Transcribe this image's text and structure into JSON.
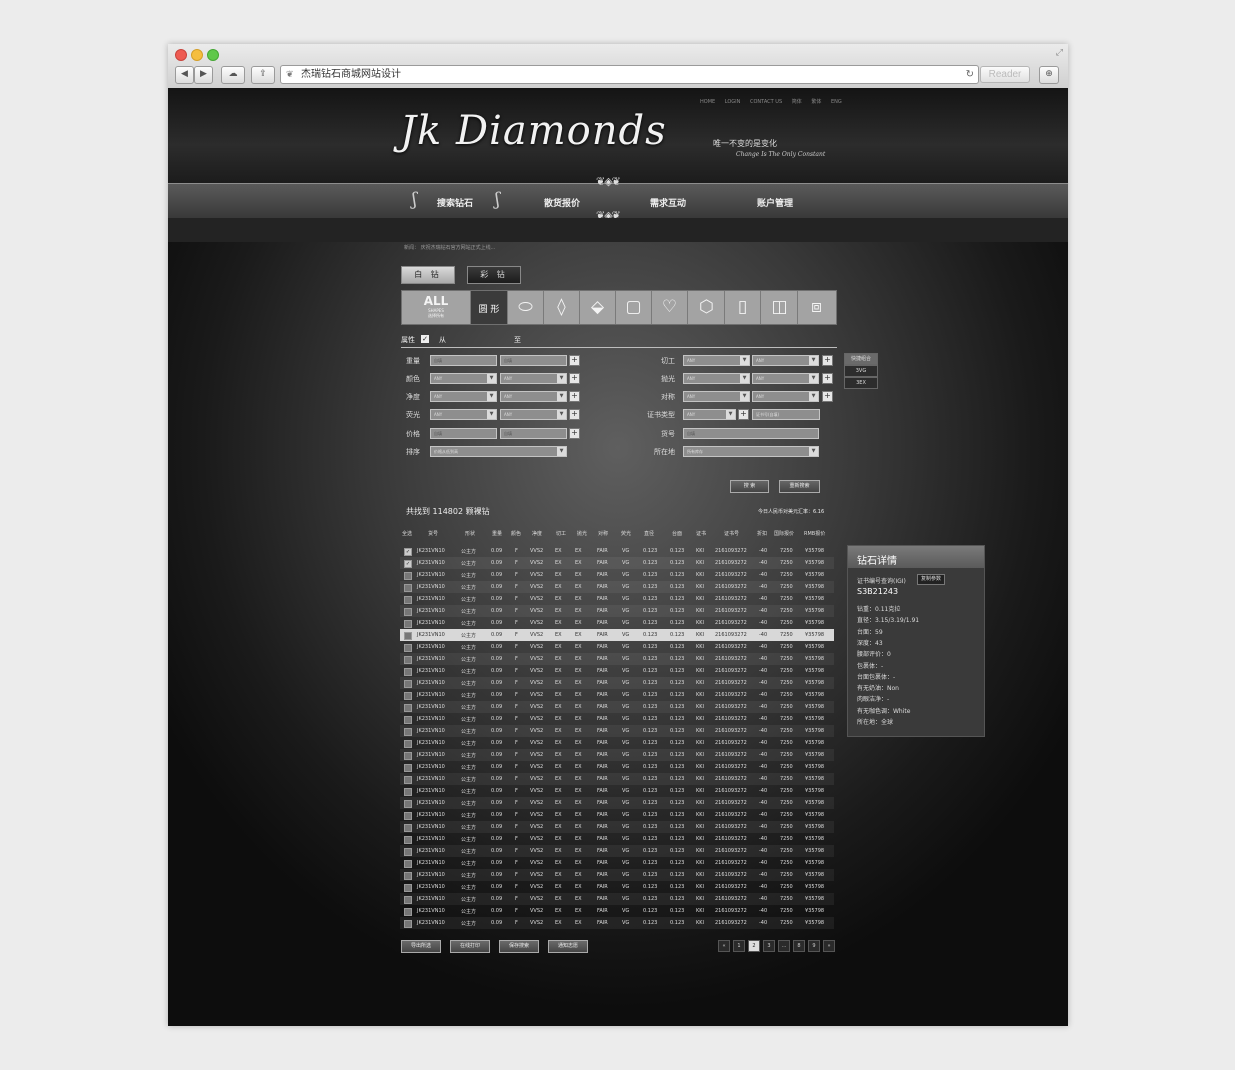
{
  "browser": {
    "address": "杰瑞钻石商城网站设计",
    "reader_label": "Reader"
  },
  "header": {
    "toplinks": [
      "HOME",
      "LOGIN",
      "CONTACT US",
      "简体",
      "繁体",
      "ENG"
    ],
    "logo": "Jk Diamonds",
    "slogan_cn": "唯一不变的是变化",
    "slogan_en": "Change Is The Only Constant"
  },
  "nav": {
    "items": [
      "搜索钻石",
      "散货报价",
      "需求互动",
      "账户管理"
    ]
  },
  "news": "新闻：  庆祝杰瑞钻石官方网站正式上线...",
  "tabs": [
    "白 钻",
    "彩 钻"
  ],
  "shapes": {
    "all_label": "ALL",
    "all_sub": "SHAPES",
    "all_cn": "选择所有",
    "round_label": "圆 形",
    "icons": [
      "oval-icon",
      "marquise-icon",
      "pear-icon",
      "princess-icon",
      "heart-icon",
      "cushion-icon",
      "emerald-icon",
      "radiant-icon",
      "asscher-icon"
    ]
  },
  "attr": {
    "label": "属性",
    "from": "从",
    "to": "至"
  },
  "filters_left": [
    {
      "label": "重量",
      "type": "input",
      "a": "自填",
      "b": "自填"
    },
    {
      "label": "颜色",
      "type": "select",
      "a": "ANY",
      "b": "ANY"
    },
    {
      "label": "净度",
      "type": "select",
      "a": "ANY",
      "b": "ANY"
    },
    {
      "label": "荧光",
      "type": "select",
      "a": "ANY",
      "b": "ANY"
    },
    {
      "label": "价格",
      "type": "input",
      "a": "自填",
      "b": "自填"
    },
    {
      "label": "排序",
      "type": "wide",
      "a": "价格从低到高"
    }
  ],
  "filters_right": [
    {
      "label": "切工",
      "a": "ANY",
      "b": "ANY"
    },
    {
      "label": "抛光",
      "a": "ANY",
      "b": "ANY"
    },
    {
      "label": "对称",
      "a": "ANY",
      "b": "ANY"
    },
    {
      "label": "证书类型",
      "a": "ANY",
      "b": "证书号(自填)"
    },
    {
      "label": "货号",
      "a": "自填"
    },
    {
      "label": "所在地",
      "a": "所有库存"
    }
  ],
  "quick": {
    "title": "快捷组合",
    "items": [
      "3VG",
      "3EX"
    ]
  },
  "search": {
    "search_btn": "搜 索",
    "reset_btn": "重新搜索"
  },
  "results": {
    "found": "共找到 114802 颗裸钻",
    "rate": "今日人民币对美元汇率：6.16",
    "columns": [
      "全选",
      "货号",
      "形状",
      "重量",
      "颜色",
      "净度",
      "切工",
      "抛光",
      "对称",
      "荧光",
      "直径",
      "台面",
      "证书",
      "证书号",
      "折扣",
      "国际报价",
      "RMB报价"
    ],
    "row": {
      "sku": "JK231VN10",
      "shape": "公主方",
      "weight": "0.09",
      "color": "F",
      "clarity": "VVS2",
      "cut": "EX",
      "polish": "EX",
      "symmetry": "FAIR",
      "fluor": "VG",
      "diameter": "0.123",
      "table": "0.123",
      "cert": "KKI",
      "cert_no": "2161093272",
      "discount": "-40",
      "intl": "7250",
      "rmb": "¥35798"
    },
    "row_count": 32
  },
  "detail": {
    "title": "钻石详情",
    "cert_query": "证书编号查询(IGI)",
    "copy": "复制参数",
    "cert": "S3B21243",
    "lines": [
      "钻重：0.11克拉",
      "直径：3.15/3.19/1.91",
      "台面：59",
      "深度：43",
      "腰部评价：0",
      "包裹体：-",
      "台面包裹体：-",
      "有无奶油：Non",
      "肉眼洁净：-",
      "有无咖色调：White",
      "所在地：全球"
    ]
  },
  "actions": [
    "导出所选",
    "在线打印",
    "保存搜索",
    "通知志愿"
  ],
  "pager": [
    "«",
    "1",
    "2",
    "3",
    "...",
    "8",
    "9",
    "»"
  ]
}
